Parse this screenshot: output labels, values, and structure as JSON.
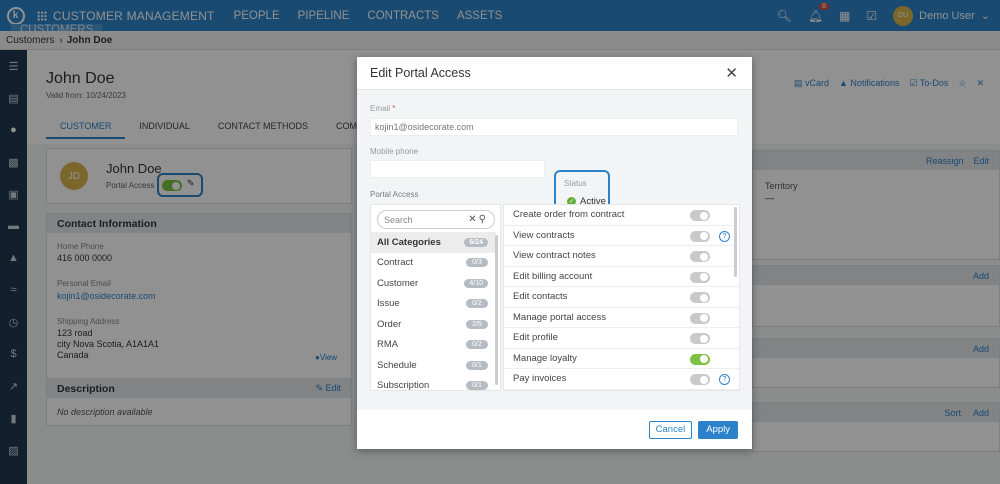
{
  "topbar": {
    "app_name": "CUSTOMER MANAGEMENT",
    "nav": [
      "CUSTOMERS",
      "PEOPLE",
      "PIPELINE",
      "CONTRACTS",
      "ASSETS"
    ],
    "active_nav": "CUSTOMERS",
    "notification_count": "8",
    "user_initials": "DU",
    "user_name": "Demo User"
  },
  "breadcrumb": {
    "root": "Customers",
    "current": "John Doe"
  },
  "page": {
    "title": "John Doe",
    "valid_from": "Valid from: 10/24/2023",
    "tabs": [
      "CUSTOMER",
      "INDIVIDUAL",
      "CONTACT METHODS",
      "COMMU"
    ],
    "header_links": {
      "vcard": "vCard",
      "notifications": "Notifications",
      "todos": "To-Dos"
    }
  },
  "profile": {
    "initials": "JD",
    "name": "John Doe",
    "portal_access_label": "Portal Access"
  },
  "contact": {
    "heading": "Contact Information",
    "home_phone_label": "Home Phone",
    "home_phone": "416 000 0000",
    "email_label": "Personal Email",
    "email": "kojin1@osidecorate.com",
    "address_label": "Shipping Address",
    "address_line1": "123 road",
    "address_line2": "city Nova Scotia, A1A1A1",
    "address_line3": "Canada",
    "view_link": "View"
  },
  "description": {
    "heading": "Description",
    "edit": "Edit",
    "empty": "No description available"
  },
  "right_panels": {
    "reassign": "Reassign",
    "edit": "Edit",
    "territory_label": "Territory",
    "territory_value": "—",
    "add": "Add",
    "sort": "Sort"
  },
  "modal": {
    "title": "Edit Portal Access",
    "email_label": "Email",
    "email_value": "kojin1@osidecorate.com",
    "mobile_label": "Mobile phone",
    "mobile_value": "",
    "status_label": "Status",
    "status_value": "Active",
    "portal_access_label": "Portal Access",
    "search_placeholder": "Search",
    "categories": [
      {
        "name": "All Categories",
        "count": "6/24"
      },
      {
        "name": "Contract",
        "count": "0/3"
      },
      {
        "name": "Customer",
        "count": "4/10"
      },
      {
        "name": "Issue",
        "count": "0/2"
      },
      {
        "name": "Order",
        "count": "2/5"
      },
      {
        "name": "RMA",
        "count": "0/2"
      },
      {
        "name": "Schedule",
        "count": "0/1"
      },
      {
        "name": "Subscription",
        "count": "0/1"
      }
    ],
    "permissions": [
      {
        "name": "Create order from contract",
        "on": false,
        "help": false
      },
      {
        "name": "View contracts",
        "on": false,
        "help": true
      },
      {
        "name": "View contract notes",
        "on": false,
        "help": false
      },
      {
        "name": "Edit billing account",
        "on": false,
        "help": false
      },
      {
        "name": "Edit contacts",
        "on": false,
        "help": false
      },
      {
        "name": "Manage portal access",
        "on": false,
        "help": false
      },
      {
        "name": "Edit profile",
        "on": false,
        "help": false
      },
      {
        "name": "Manage loyalty",
        "on": true,
        "help": false
      },
      {
        "name": "Pay invoices",
        "on": false,
        "help": true
      }
    ],
    "cancel_label": "Cancel",
    "apply_label": "Apply"
  },
  "colors": {
    "primary": "#2b82c9",
    "sidebar": "#20394f",
    "toggle_on": "#7dc242",
    "status_ok": "#62b03b"
  }
}
